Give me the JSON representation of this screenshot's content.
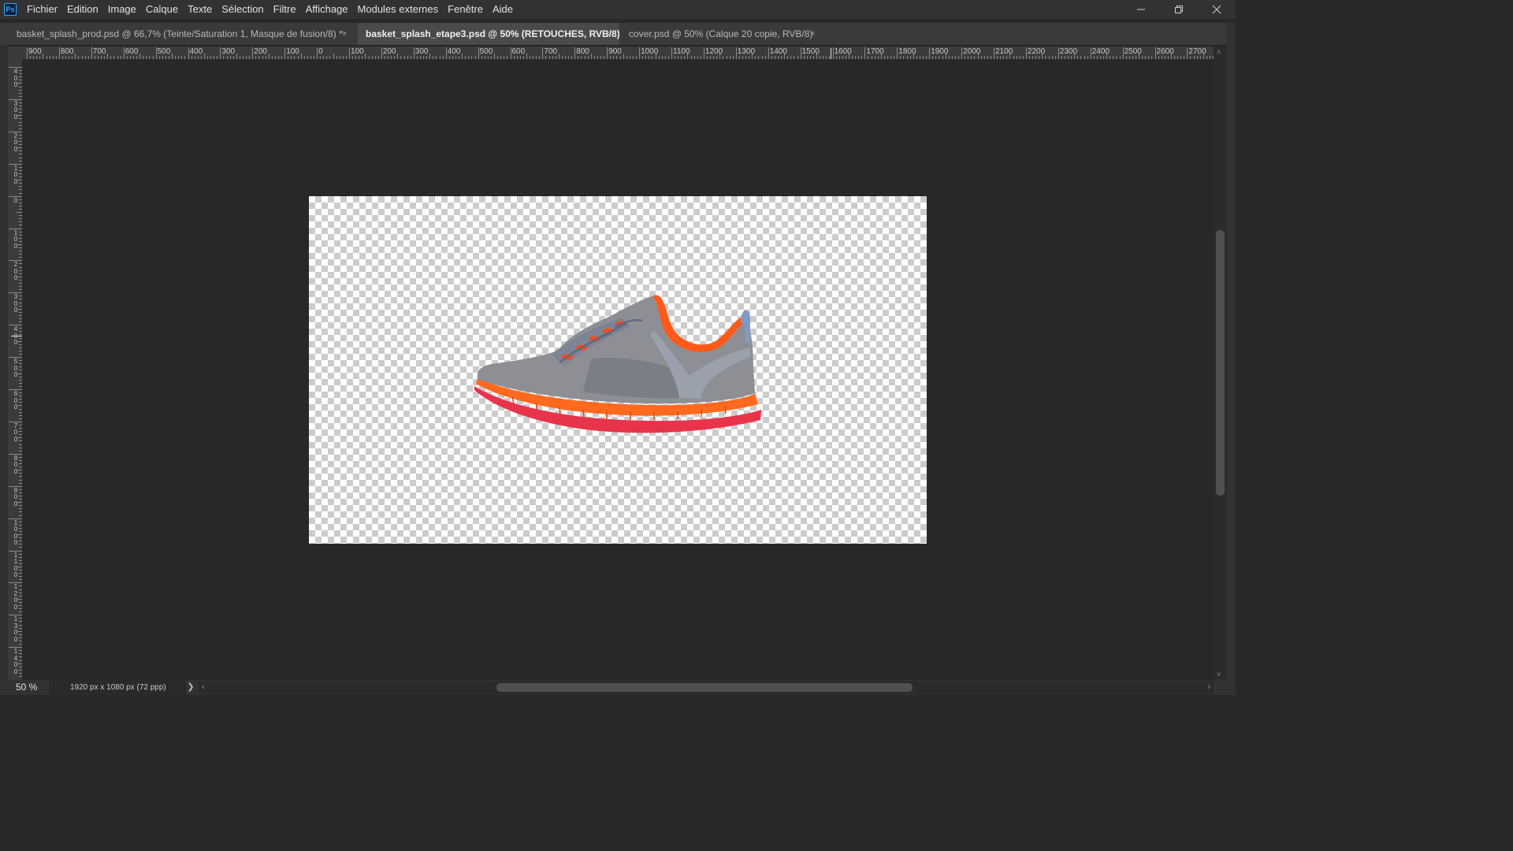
{
  "app": {
    "logo": "Ps"
  },
  "menu": [
    "Fichier",
    "Edition",
    "Image",
    "Calque",
    "Texte",
    "Sélection",
    "Filtre",
    "Affichage",
    "Modules externes",
    "Fenêtre",
    "Aide"
  ],
  "window_controls": {
    "minimize": "—",
    "restore": "❐",
    "close": "✕"
  },
  "tabs": [
    {
      "label": "basket_splash_prod.psd @ 66,7% (Teinte/Saturation 1, Masque de fusion/8) *",
      "active": false,
      "close": "×"
    },
    {
      "label": "basket_splash_etape3.psd @ 50% (RETOUCHES, RVB/8) *",
      "active": true,
      "close": "×"
    },
    {
      "label": "cover.psd @ 50% (Calque 20 copie, RVB/8)",
      "active": false,
      "close": "×"
    }
  ],
  "ruler_h_labels": [
    "900",
    "800",
    "700",
    "600",
    "500",
    "400",
    "300",
    "200",
    "100",
    "0",
    "100",
    "200",
    "300",
    "400",
    "500",
    "600",
    "700",
    "800",
    "900",
    "1000",
    "1100",
    "1200",
    "1300",
    "1400",
    "1500",
    "1600",
    "1700",
    "1800",
    "1900",
    "2000",
    "2100",
    "2200",
    "2300",
    "2400",
    "2500",
    "2600",
    "2700"
  ],
  "ruler_v_labels": [
    "400",
    "300",
    "200",
    "100",
    "0",
    "100",
    "200",
    "300",
    "400",
    "500",
    "600",
    "700",
    "800",
    "900",
    "1000",
    "1100",
    "1200",
    "1300",
    "1400"
  ],
  "canvas": {
    "content": "sneaker",
    "colors": {
      "upper": "#8d8f95",
      "trim": "#ff5a1a",
      "sole": "#ff6a1f",
      "outsole": "#e8344a",
      "laces": "#ff4a1a"
    }
  },
  "status": {
    "zoom": "50 %",
    "doc_info": "1920 px x 1080 px (72 ppp)",
    "arrow": "❯"
  },
  "scroll": {
    "left_arrow": "‹",
    "right_arrow": "›",
    "up_arrow": "˄",
    "down_arrow": "˅"
  }
}
